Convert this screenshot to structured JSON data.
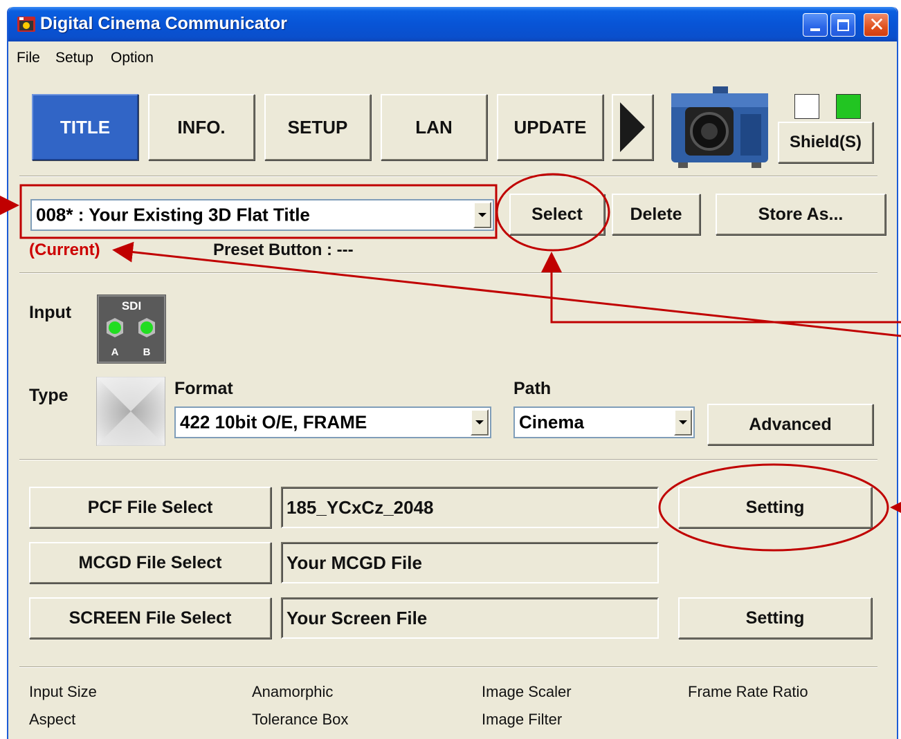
{
  "window": {
    "title": "Digital Cinema Communicator"
  },
  "menu": [
    "File",
    "Setup",
    "Option"
  ],
  "tabs": [
    {
      "label": "TITLE",
      "active": true
    },
    {
      "label": "INFO.",
      "active": false
    },
    {
      "label": "SETUP",
      "active": false
    },
    {
      "label": "LAN",
      "active": false
    },
    {
      "label": "UPDATE",
      "active": false
    }
  ],
  "shield": {
    "label": "Shield(S)",
    "indicator_colors": [
      "#ffffff",
      "#22c522"
    ]
  },
  "title_select": {
    "value": "008* : Your Existing 3D Flat Title",
    "status": "(Current)",
    "preset": "Preset Button : ---",
    "select_label": "Select",
    "delete_label": "Delete",
    "store_label": "Store As..."
  },
  "input": {
    "label": "Input",
    "badge": "SDI",
    "ports": [
      "A",
      "B"
    ]
  },
  "type": {
    "label": "Type",
    "format_label": "Format",
    "format_value": "422 10bit O/E, FRAME",
    "path_label": "Path",
    "path_value": "Cinema",
    "advanced_label": "Advanced"
  },
  "files": {
    "pcf_button": "PCF File Select",
    "pcf_value": "185_YCxCz_2048",
    "pcf_setting": "Setting",
    "mcgd_button": "MCGD File Select",
    "mcgd_value": "Your MCGD File",
    "screen_button": "SCREEN File Select",
    "screen_value": "Your Screen File",
    "screen_setting": "Setting"
  },
  "footer": {
    "input_size": "Input Size",
    "anamorphic": "Anamorphic",
    "image_scaler": "Image Scaler",
    "frame_rate_ratio": "Frame Rate Ratio",
    "aspect": "Aspect",
    "tolerance_box": "Tolerance Box",
    "image_filter": "Image Filter"
  },
  "colors": {
    "annotation": "#c00000",
    "active_tab": "#3165c6",
    "window_bg": "#ece9d8"
  }
}
